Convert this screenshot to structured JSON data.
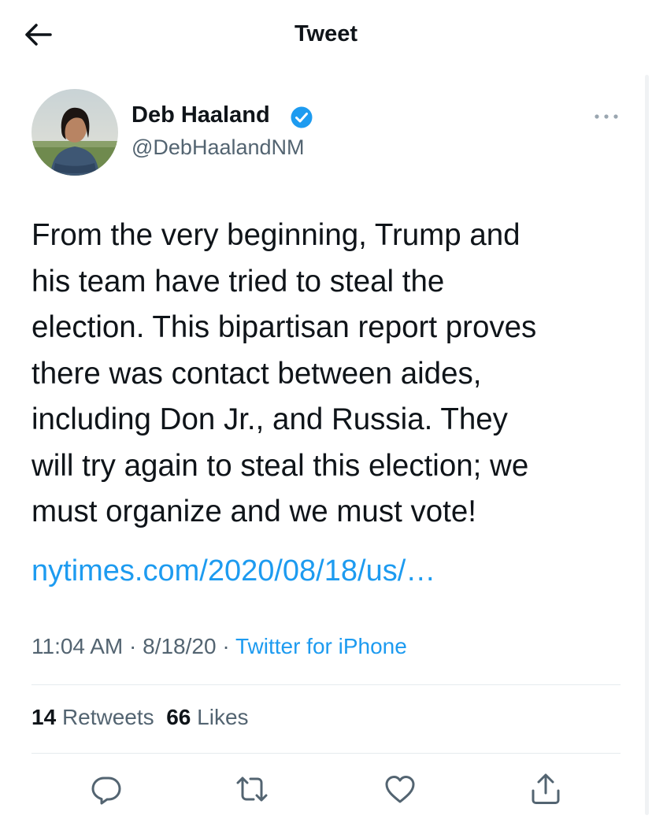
{
  "header": {
    "title": "Tweet"
  },
  "author": {
    "display_name": "Deb Haaland",
    "handle": "@DebHaalandNM",
    "verified": true
  },
  "tweet": {
    "text_lines": [
      "From the very beginning, Trump and",
      "his team have tried to steal the",
      "election. This bipartisan report proves",
      "there was contact between aides,",
      "including Don Jr., and Russia. They",
      "will try again to steal this election; we",
      "must organize and we must vote!"
    ],
    "link": "nytimes.com/2020/08/18/us/…"
  },
  "meta": {
    "time": "11:04 AM",
    "separator": "·",
    "date": "8/18/20",
    "source": "Twitter for iPhone"
  },
  "stats": {
    "retweets_count": "14",
    "retweets_label": "Retweets",
    "likes_count": "66",
    "likes_label": "Likes"
  },
  "actions": [
    "reply-icon",
    "retweet-icon",
    "like-icon",
    "share-icon"
  ],
  "colors": {
    "link": "#1d9bf0",
    "secondary_text": "#536471",
    "text": "#0f1419",
    "divider": "#e6ebee"
  }
}
